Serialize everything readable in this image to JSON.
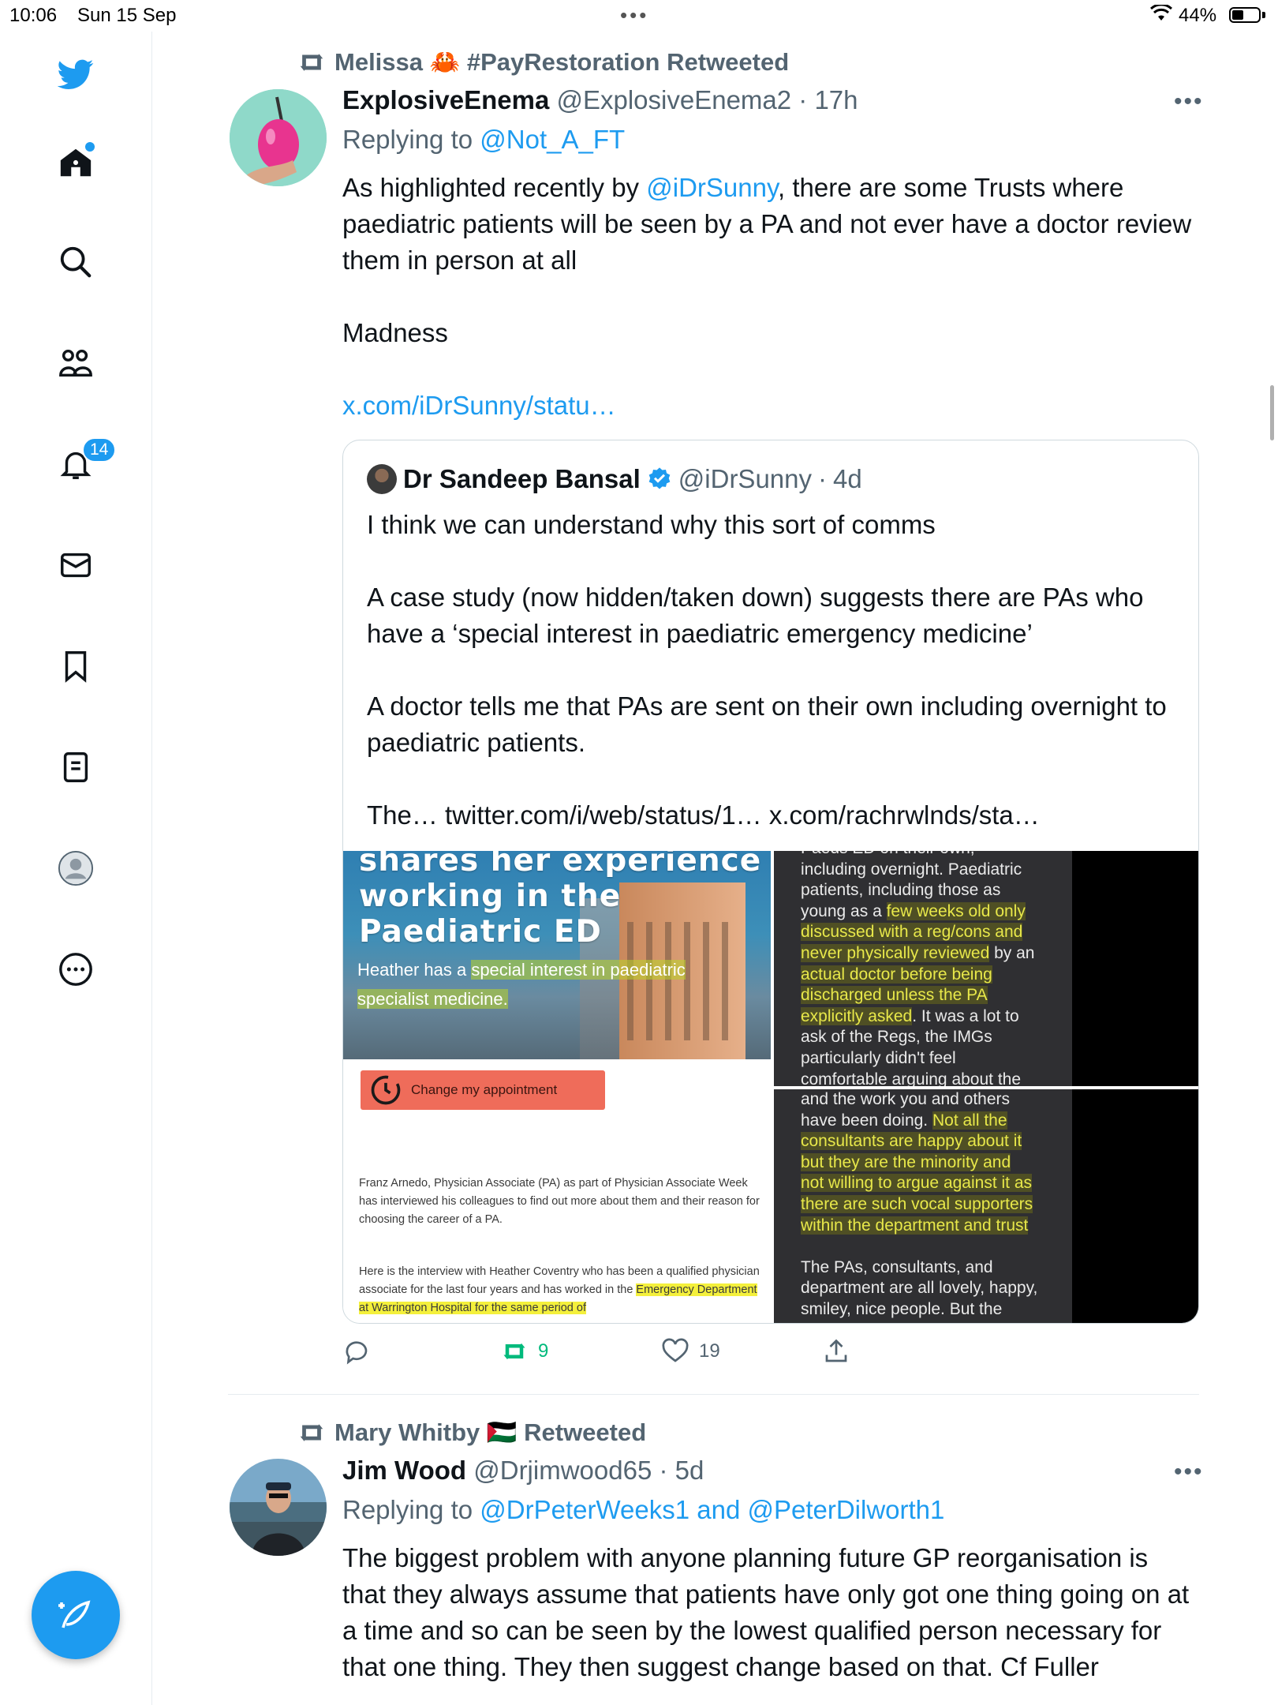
{
  "status_bar": {
    "time": "10:06",
    "date": "Sun 15 Sep",
    "battery": "44%"
  },
  "sidebar": {
    "notification_count": "14",
    "items": [
      "twitter-logo",
      "home",
      "search",
      "communities",
      "notifications",
      "messages",
      "bookmarks",
      "lists",
      "profile",
      "more"
    ]
  },
  "tweets": [
    {
      "retweeted_by": "Melissa 🦀 #PayRestoration Retweeted",
      "name": "ExplosiveEnema",
      "handle": "@ExplosiveEnema2",
      "time": "17h",
      "replying_prefix": "Replying to ",
      "replying_to": "@Not_A_FT",
      "text_pre": "As highlighted recently by ",
      "mention": "@iDrSunny",
      "text_post": ", there are some Trusts where paediatric patients will be seen by a PA and not ever have a doctor review them in person at all\n\nMadness\n\n",
      "link": "x.com/iDrSunny/statu…",
      "quote": {
        "name": "Dr Sandeep Bansal",
        "handle": "@iDrSunny",
        "time": "4d",
        "text": "I think we can understand why this sort of comms\n\nA case study (now hidden/taken down) suggests there are PAs who have a ‘special interest in paediatric emergency medicine’\n\nA doctor tells me that PAs are sent on their own including overnight to paediatric patients.\n\nThe… twitter.com/i/web/status/1… x.com/rachrwlnds/sta…",
        "media": {
          "image1_title": "shares her experience\nworking in the\nPaediatric ED",
          "image1_sub_pre": "Heather has a ",
          "image1_sub_hl": "special interest in paediatric specialist medicine.",
          "image1_button": "Change my appointment",
          "image1_para1": "Franz Arnedo, Physician Associate (PA) as part of Physician Associate Week has interviewed his colleagues to find out more about them and their reason for choosing the career of a PA.",
          "image1_para2_pre": "Here is the interview with Heather Coventry who has been a qualified physician associate for the last four years and has worked in the ",
          "image1_para2_hl": "Emergency Department at Warrington Hospital for the same period of",
          "image2_lines": [
            {
              "t": "Paeds ED on their own,",
              "h": false
            },
            {
              "t": "including overnight. Paediatric",
              "h": false
            },
            {
              "t": "patients, including those as",
              "h": false
            },
            {
              "t": "young as a ",
              "h": false,
              "tail": "few weeks old only"
            },
            {
              "t": "discussed with a reg/cons and",
              "h": true
            },
            {
              "t": "never physically reviewed",
              "h": true,
              "tail2": " by an"
            },
            {
              "t": "actual doctor before being",
              "h": true
            },
            {
              "t": "discharged unless the PA",
              "h": true
            },
            {
              "t": "explicitly asked",
              "h": true,
              "tail2": ". It was a lot to"
            },
            {
              "t": "ask of the Regs, the IMGs",
              "h": false
            },
            {
              "t": "particularly didn't feel",
              "h": false
            },
            {
              "t": "comfortable arguing about the",
              "h": false
            }
          ],
          "image3_lines": [
            {
              "t": "and the work you and others",
              "h": false
            },
            {
              "t": "have been doing. ",
              "h": false,
              "tail": "Not all the"
            },
            {
              "t": "consultants are happy about it",
              "h": true
            },
            {
              "t": "but they are the minority and",
              "h": true
            },
            {
              "t": "not willing to argue against it as",
              "h": true
            },
            {
              "t": "there are such vocal supporters",
              "h": true
            },
            {
              "t": "within the department and trust",
              "h": true
            },
            {
              "t": "",
              "h": false
            },
            {
              "t": "The PAs, consultants, and",
              "h": false
            },
            {
              "t": "department are all lovely, happy,",
              "h": false
            },
            {
              "t": "smiley, nice people. But the",
              "h": false
            }
          ]
        }
      },
      "actions": {
        "reply_count": "",
        "retweet_count": "9",
        "like_count": "19"
      }
    },
    {
      "retweeted_by": "Mary Whitby 🇵🇸 Retweeted",
      "name": "Jim Wood",
      "handle": "@Drjimwood65",
      "time": "5d",
      "replying_prefix": "Replying to ",
      "replying_to": "@DrPeterWeeks1 and @PeterDilworth1",
      "text": "The biggest problem with anyone planning future GP reorganisation is that they always assume that patients have only got one thing going on at a time and so can be seen by the lowest qualified person necessary for that one thing. They then suggest change based on that. Cf Fuller"
    }
  ],
  "colors": {
    "accent": "#1d9bf0",
    "retweet_green": "#00ba7c",
    "text": "#0f1419",
    "muted": "#536471"
  }
}
